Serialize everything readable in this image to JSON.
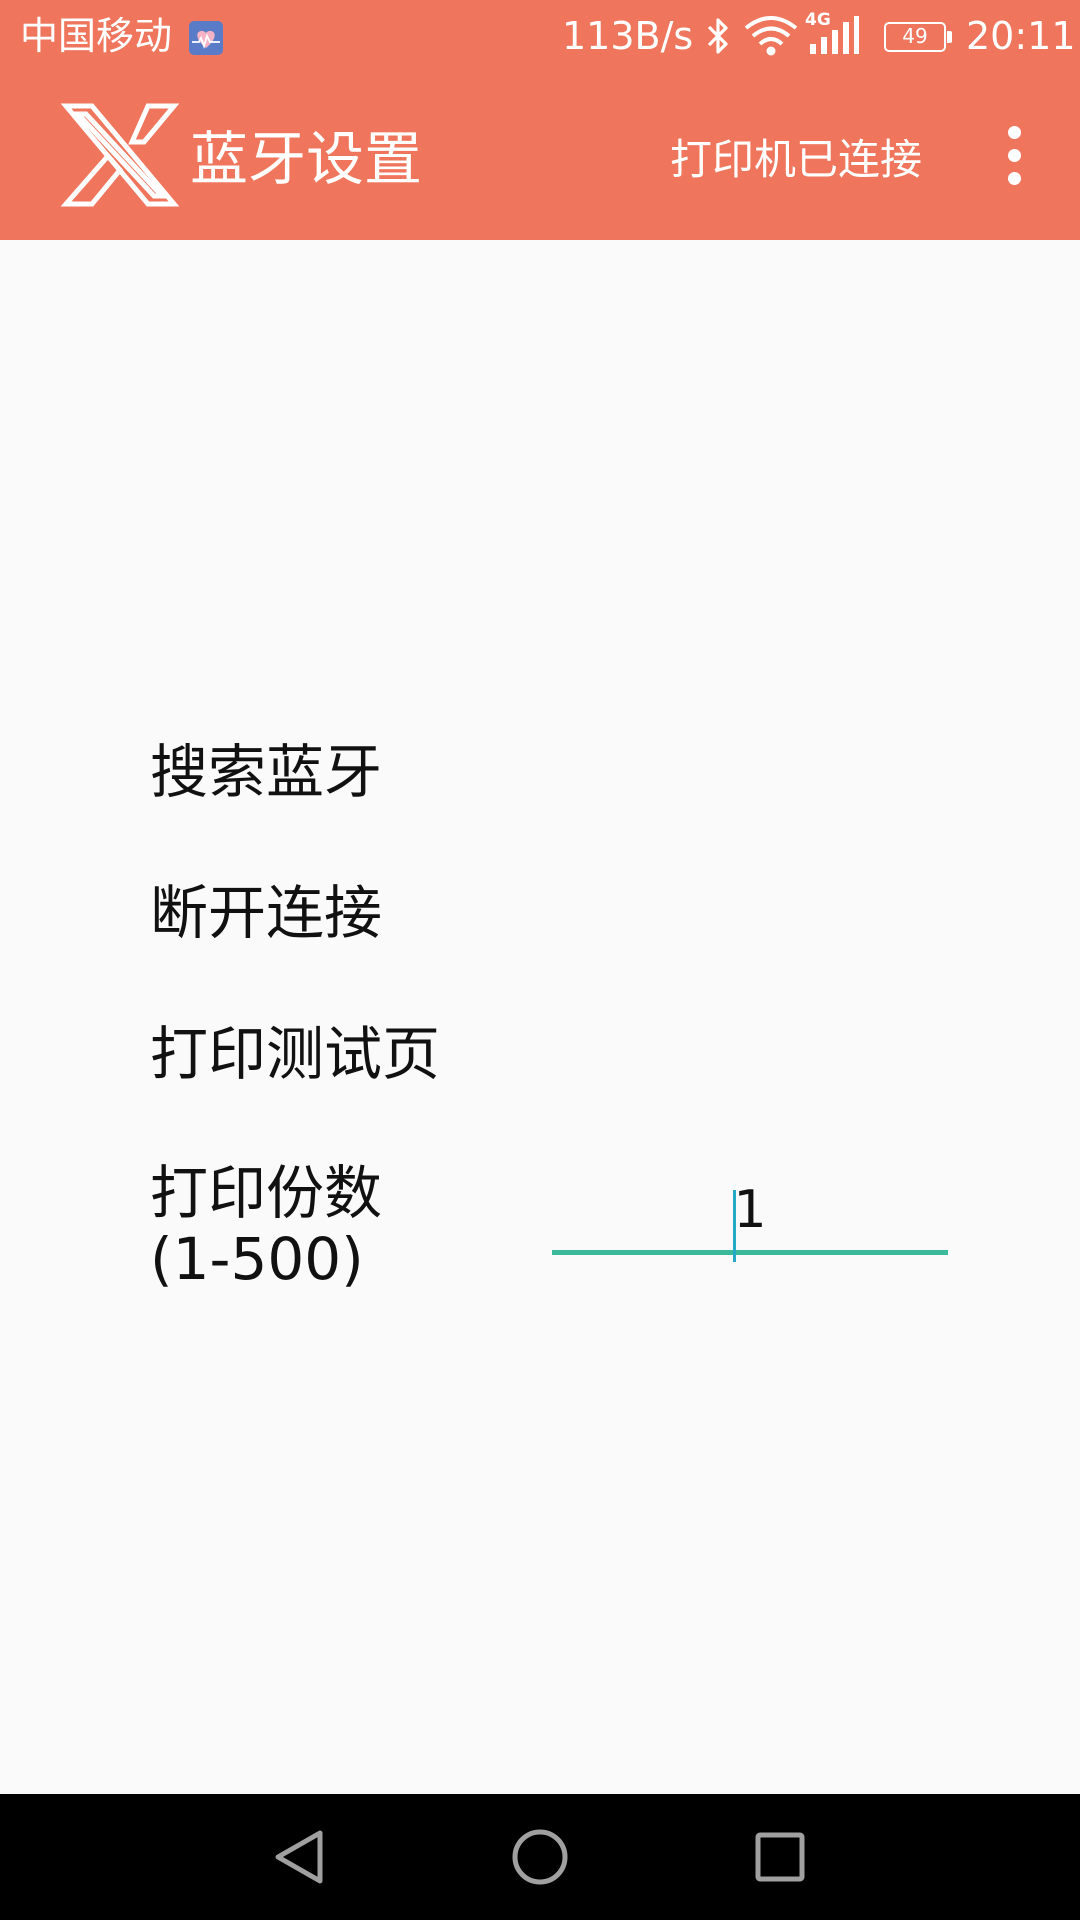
{
  "status_bar": {
    "carrier": "中国移动",
    "network_speed": "113B/s",
    "network_type": "4G",
    "battery_level": "49",
    "time": "20:11"
  },
  "app_bar": {
    "title": "蓝牙设置",
    "printer_status": "打印机已连接"
  },
  "menu": {
    "search_bluetooth": "搜索蓝牙",
    "disconnect": "断开连接",
    "print_test_page": "打印测试页"
  },
  "print_copies": {
    "label_line1": "打印份数",
    "label_line2": "(1-500)",
    "value": "1"
  },
  "colors": {
    "primary": "#ef765c",
    "accent": "#3bb99a",
    "cursor": "#25a9c4"
  },
  "icons": {
    "status_bar": [
      "health-icon",
      "bluetooth-icon",
      "wifi-icon",
      "signal-icon",
      "battery-icon"
    ],
    "app_bar": [
      "app-logo-icon",
      "overflow-menu-icon"
    ],
    "nav_bar": [
      "back-icon",
      "home-icon",
      "recents-icon"
    ]
  }
}
